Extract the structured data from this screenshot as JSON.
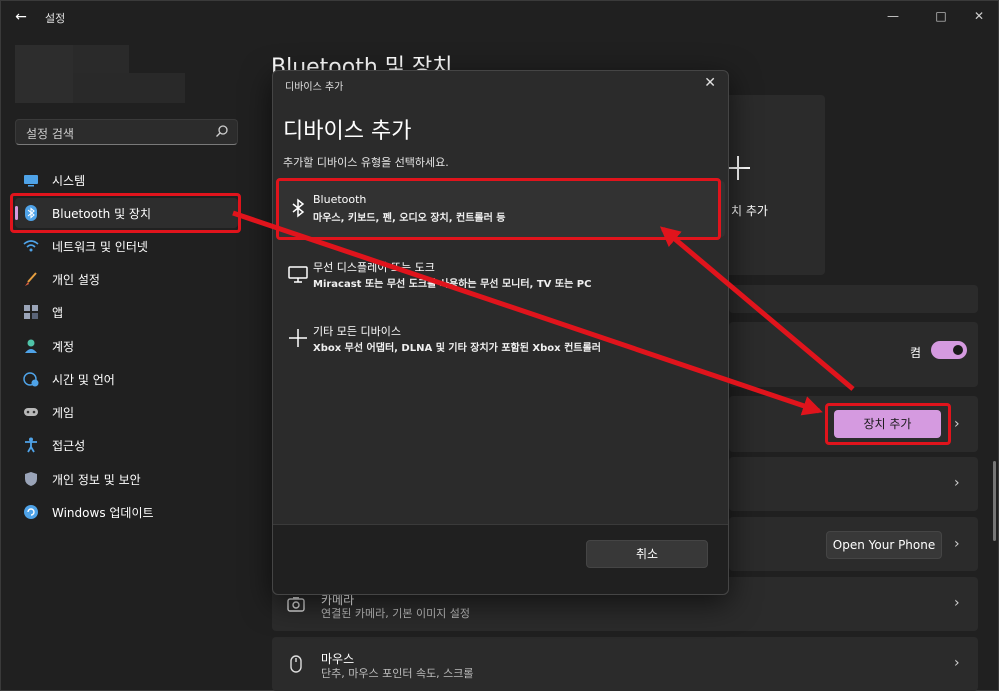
{
  "window": {
    "title": "설정"
  },
  "search": {
    "placeholder": "설정 검색"
  },
  "sidebar": {
    "items": [
      {
        "label": "시스템",
        "icon": "monitor-icon"
      },
      {
        "label": "Bluetooth 및 장치",
        "icon": "bluetooth-icon",
        "active": true
      },
      {
        "label": "네트워크 및 인터넷",
        "icon": "wifi-icon"
      },
      {
        "label": "개인 설정",
        "icon": "brush-icon"
      },
      {
        "label": "앱",
        "icon": "apps-icon"
      },
      {
        "label": "계정",
        "icon": "person-icon"
      },
      {
        "label": "시간 및 언어",
        "icon": "globe-clock-icon"
      },
      {
        "label": "게임",
        "icon": "gamepad-icon"
      },
      {
        "label": "접근성",
        "icon": "accessibility-icon"
      },
      {
        "label": "개인 정보 및 보안",
        "icon": "shield-icon"
      },
      {
        "label": "Windows 업데이트",
        "icon": "update-icon"
      }
    ]
  },
  "main": {
    "page_title": "Bluetooth 및 장치",
    "add_card_label": "치 추가",
    "bluetooth_toggle": {
      "label": "켬",
      "on": true
    },
    "add_device_button": "장치 추가",
    "phone_button": "Open Your Phone",
    "rows": [
      {
        "title": "카메라",
        "subtitle": "연결된 카메라, 기본 이미지 설정",
        "icon": "camera-icon"
      },
      {
        "title": "마우스",
        "subtitle": "단추, 마우스 포인터 속도, 스크롤",
        "icon": "mouse-icon"
      }
    ]
  },
  "dialog": {
    "caption": "디바이스 추가",
    "heading": "디바이스 추가",
    "prompt": "추가할 디바이스 유형을 선택하세요.",
    "options": [
      {
        "title": "Bluetooth",
        "subtitle": "마우스, 키보드, 펜, 오디오 장치, 컨트롤러 등",
        "icon": "bluetooth-icon"
      },
      {
        "title": "무선 디스플레이 또는 도크",
        "subtitle": "Miracast 또는 무선 도크를 사용하는 무선 모니터, TV 또는 PC",
        "icon": "monitor-icon"
      },
      {
        "title": "기타 모든 디바이스",
        "subtitle": "Xbox 무선 어댑터, DLNA 및 기타 장치가 포함된 Xbox 컨트롤러",
        "icon": "plus-icon"
      }
    ],
    "cancel_label": "취소"
  },
  "colors": {
    "accent": "#d59ae0",
    "highlight": "#e0141c",
    "background": "#202020",
    "card": "#2b2b2b"
  }
}
